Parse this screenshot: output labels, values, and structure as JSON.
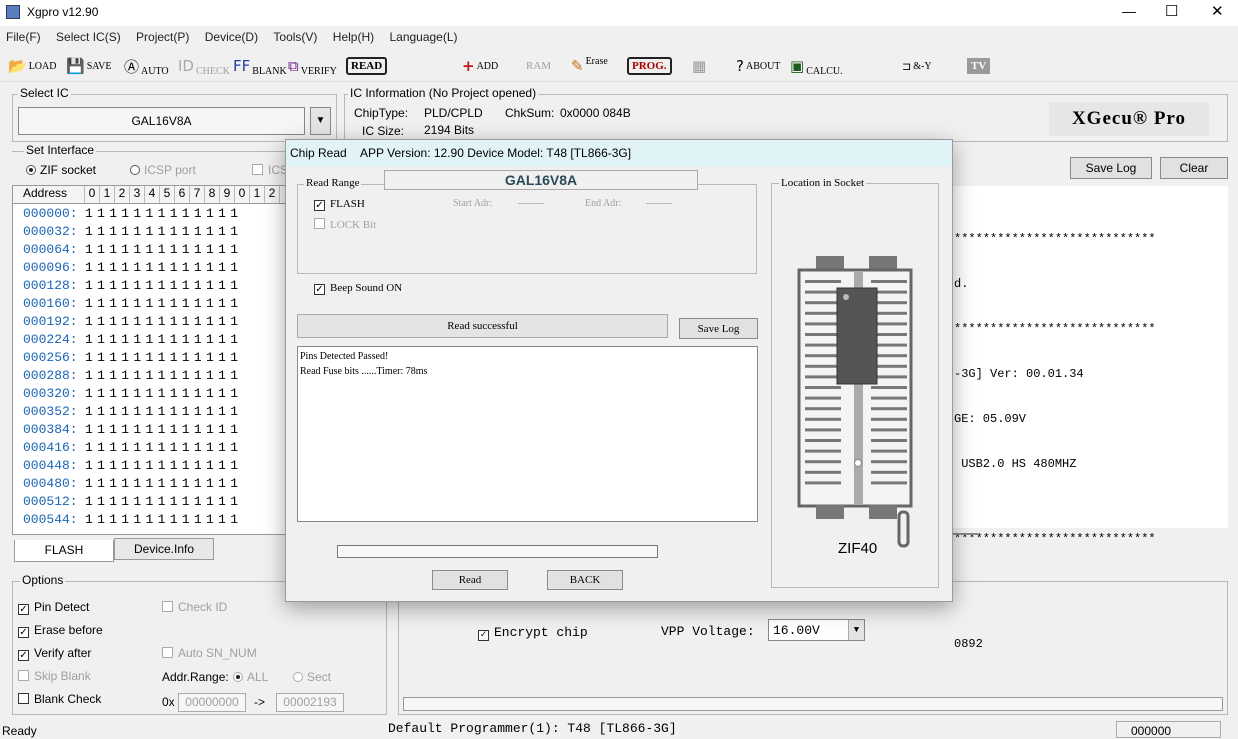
{
  "window": {
    "title": "Xgpro v12.90",
    "controls": [
      "—",
      "☐",
      "✕"
    ]
  },
  "menu": [
    "File(F)",
    "Select IC(S)",
    "Project(P)",
    "Device(D)",
    "Tools(V)",
    "Help(H)",
    "Language(L)"
  ],
  "toolbar": {
    "load": "LOAD",
    "save": "SAVE",
    "auto": "AUTO",
    "check": "CHECK",
    "blank": "BLANK",
    "verify": "VERIFY",
    "read": "READ",
    "add": "ADD",
    "ram": "RAM",
    "erase": "Erase",
    "prog": "PROG.",
    "about": "ABOUT",
    "calcu": "CALCU.",
    "logic": "&-Y",
    "tv": "TV"
  },
  "select_ic": {
    "label": "Select IC",
    "value": "GAL16V8A"
  },
  "ic_info": {
    "label": "IC Information (No Project opened)",
    "chiptype_label": "ChipType:",
    "chiptype": "PLD/CPLD",
    "checksum_label": "ChkSum:",
    "checksum": "0x0000 084B",
    "size_label": "IC Size:",
    "size": "2194 Bits"
  },
  "brand": "XGecu® Pro",
  "interface": {
    "label": "Set Interface",
    "zif": "ZIF socket",
    "icsp": "ICSP port",
    "ics": "ICS"
  },
  "hex": {
    "header": [
      "Address",
      "0",
      "1",
      "2",
      "3",
      "4",
      "5",
      "6",
      "7",
      "8",
      "9",
      "0",
      "1",
      "2"
    ],
    "rows": [
      "000000:",
      "000032:",
      "000064:",
      "000096:",
      "000128:",
      "000160:",
      "000192:",
      "000224:",
      "000256:",
      "000288:",
      "000320:",
      "000352:",
      "000384:",
      "000416:",
      "000448:",
      "000480:",
      "000512:",
      "000544:"
    ],
    "bits": "1111111111111"
  },
  "tabs": {
    "flash": "FLASH",
    "devinfo": "Device.Info"
  },
  "options": {
    "label": "Options",
    "pin_detect": "Pin Detect",
    "erase_before": "Erase before",
    "verify_after": "Verify after",
    "skip_blank": "Skip Blank",
    "blank_check": "Blank Check",
    "check_id": "Check ID",
    "auto_sn": "Auto SN_NUM",
    "addr_range": "Addr.Range:",
    "all": "ALL",
    "sect": "Sect",
    "prefix": "0x",
    "start": "00000000",
    "arrow": "->",
    "end": "00002193"
  },
  "logpanel": {
    "save_log": "Save Log",
    "clear": "Clear",
    "lines": [
      "****************************",
      "d.",
      "****************************",
      "-3G] Ver: 00.01.34",
      "GE: 05.09V",
      " USB2.0 HS 480MHZ",
      "",
      "****************************",
      "",
      "",
      "0892"
    ]
  },
  "encrypt": {
    "label": "Encrypt chip",
    "vpp_label": "VPP Voltage:",
    "vpp_value": "16.00V"
  },
  "status": {
    "left": "Ready",
    "center": "Default Programmer(1): T48 [TL866-3G]",
    "right": "000000"
  },
  "dialog": {
    "title": "Chip Read",
    "app_version": "APP Version: 12.90 Device Model: T48 [TL866-3G]",
    "read_range": "Read Range",
    "chip_name": "GAL16V8A",
    "flash": "FLASH",
    "lock_bit": "LOCK Bit",
    "start_adr": "Start Adr:",
    "start_val": "--------",
    "end_adr": "End Adr:",
    "end_val": "--------",
    "beep": "Beep Sound ON",
    "status": "Read successful",
    "save_log": "Save Log",
    "log_lines": [
      "Pins Detected Passed!",
      "Read Fuse bits ......Timer: 78ms"
    ],
    "progress": 0,
    "read_btn": "Read",
    "back_btn": "BACK",
    "location_label": "Location in Socket",
    "socket_name": "ZIF40"
  }
}
